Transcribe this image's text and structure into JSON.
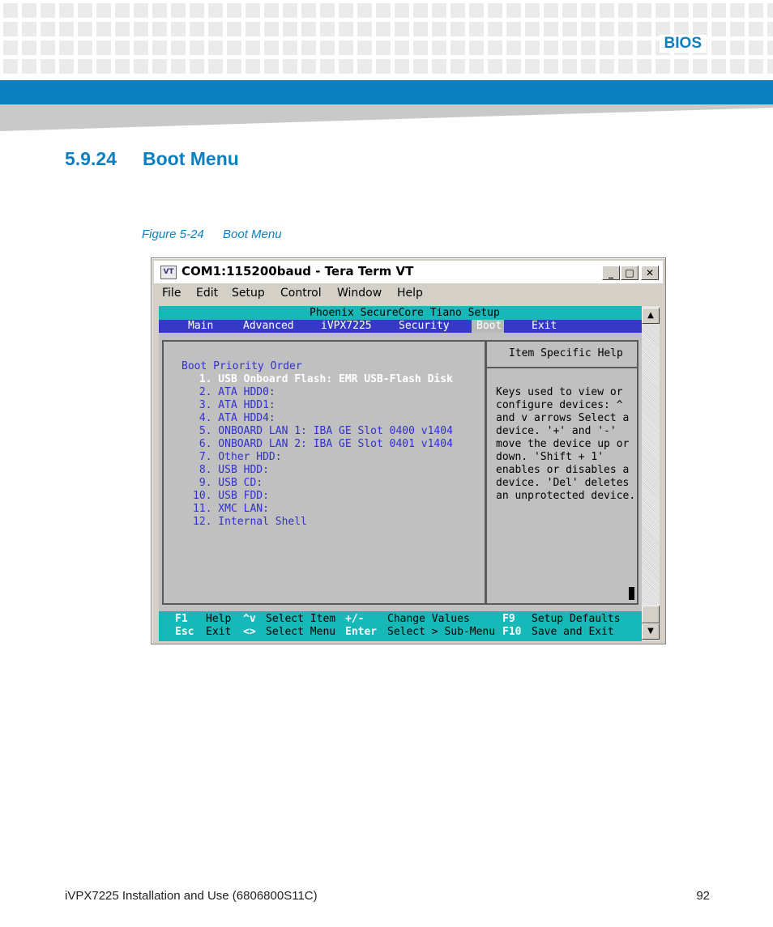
{
  "page_header": {
    "section": "BIOS",
    "accent_color": "#0b7fc0"
  },
  "section_heading": {
    "number": "5.9.24",
    "title": "Boot Menu"
  },
  "figure_caption": {
    "number": "Figure 5-24",
    "title": "Boot Menu"
  },
  "window": {
    "icon_label": "VT",
    "title": "COM1:115200baud - Tera Term VT",
    "controls": {
      "minimize": "_",
      "maximize": "□",
      "close": "✕"
    },
    "menu": [
      "File",
      "Edit",
      "Setup",
      "Control",
      "Window",
      "Help"
    ]
  },
  "bios": {
    "setup_title": "Phoenix SecureCore Tiano Setup",
    "tabs": [
      "Main",
      "Advanced",
      "iVPX7225",
      "Security",
      "Boot",
      "Exit"
    ],
    "active_tab": "Boot",
    "boot_priority_heading": "Boot Priority Order",
    "boot_items": [
      " 1. USB Onboard Flash: EMR USB-Flash Disk",
      " 2. ATA HDD0:",
      " 3. ATA HDD1:",
      " 4. ATA HDD4:",
      " 5. ONBOARD LAN 1: IBA GE Slot 0400 v1404",
      " 6. ONBOARD LAN 2: IBA GE Slot 0401 v1404",
      " 7. Other HDD:",
      " 8. USB HDD:",
      " 9. USB CD:",
      "10. USB FDD:",
      "11. XMC LAN:",
      "12. Internal Shell"
    ],
    "help_title": "Item Specific Help",
    "help_lines": [
      "Keys used to view or",
      "configure devices: ^",
      "and v arrows Select a",
      "device. '+' and '-'",
      "move the device up or",
      "down. 'Shift + 1'",
      "enables or disables a",
      "device. 'Del' deletes",
      "an unprotected device."
    ],
    "footer_keys": {
      "f1": "F1",
      "f1_label": "Help",
      "arrows_ud": "^v",
      "arrows_ud_label": "Select Item",
      "plusminus": "+/-",
      "plusminus_label": "Change Values",
      "f9": "F9",
      "f9_label": "Setup Defaults",
      "esc": "Esc",
      "esc_label": "Exit",
      "arrows_lr": "<>",
      "arrows_lr_label": "Select Menu",
      "enter": "Enter",
      "enter_label": "Select > Sub-Menu",
      "f10": "F10",
      "f10_label": "Save and Exit"
    },
    "colors": {
      "cyan": "#17b8b8",
      "blue": "#3838c8",
      "text_blue": "#3030d0",
      "gray": "#c0c0c0"
    }
  },
  "footer": {
    "document": "iVPX7225 Installation and Use (6806800S11C)",
    "page_number": "92"
  }
}
